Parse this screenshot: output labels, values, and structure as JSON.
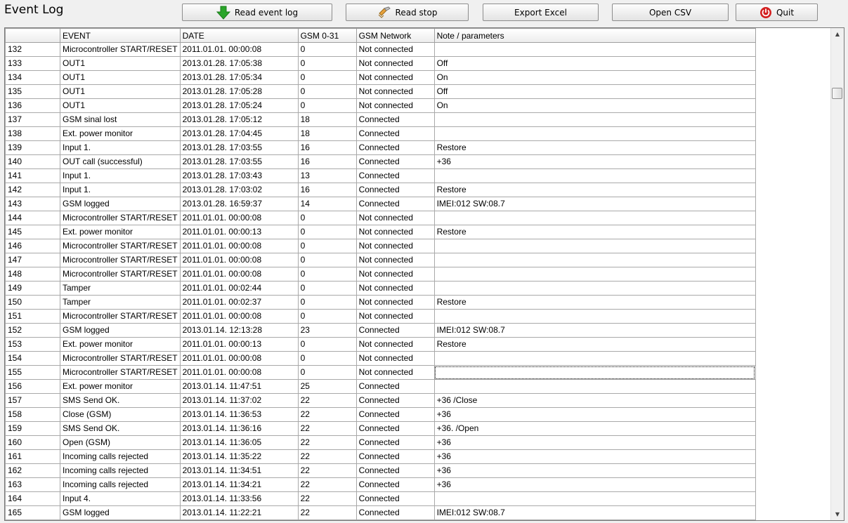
{
  "window": {
    "title": "Event Log"
  },
  "toolbar": {
    "read_label": "Read event log",
    "stop_label": "Read stop",
    "export_label": "Export Excel",
    "open_label": "Open CSV",
    "quit_label": "Quit"
  },
  "icons": {
    "read": "green-down-arrow-icon",
    "stop": "broom-icon",
    "quit": "power-icon"
  },
  "colors": {
    "read_icon": "#2aa52a",
    "quit_icon": "#d32020"
  },
  "columns": [
    "",
    "EVENT",
    "DATE",
    "GSM 0-31",
    "GSM Network",
    "Note / parameters"
  ],
  "rows": [
    {
      "n": "132",
      "event": "Microcontroller START/RESET",
      "date": "2011.01.01.   00:00:08",
      "gsm": "0",
      "net": "Not connected",
      "note": ""
    },
    {
      "n": "133",
      "event": "OUT1",
      "date": "2013.01.28.   17:05:38",
      "gsm": "0",
      "net": "Not connected",
      "note": "Off"
    },
    {
      "n": "134",
      "event": "OUT1",
      "date": "2013.01.28.   17:05:34",
      "gsm": "0",
      "net": "Not connected",
      "note": "On"
    },
    {
      "n": "135",
      "event": "OUT1",
      "date": "2013.01.28.   17:05:28",
      "gsm": "0",
      "net": "Not connected",
      "note": "Off"
    },
    {
      "n": "136",
      "event": "OUT1",
      "date": "2013.01.28.   17:05:24",
      "gsm": "0",
      "net": "Not connected",
      "note": "On"
    },
    {
      "n": "137",
      "event": "GSM sinal lost",
      "date": "2013.01.28.   17:05:12",
      "gsm": "18",
      "net": "Connected",
      "note": ""
    },
    {
      "n": "138",
      "event": "Ext. power monitor",
      "date": "2013.01.28.   17:04:45",
      "gsm": "18",
      "net": "Connected",
      "note": ""
    },
    {
      "n": "139",
      "event": "Input 1.",
      "date": "2013.01.28.   17:03:55",
      "gsm": "16",
      "net": "Connected",
      "note": "Restore"
    },
    {
      "n": "140",
      "event": "OUT call (successful)",
      "date": "2013.01.28.   17:03:55",
      "gsm": "16",
      "net": "Connected",
      "note": "+36"
    },
    {
      "n": "141",
      "event": "Input 1.",
      "date": "2013.01.28.   17:03:43",
      "gsm": "13",
      "net": "Connected",
      "note": ""
    },
    {
      "n": "142",
      "event": "Input 1.",
      "date": "2013.01.28.   17:03:02",
      "gsm": "16",
      "net": "Connected",
      "note": "Restore"
    },
    {
      "n": "143",
      "event": "GSM logged",
      "date": "2013.01.28.   16:59:37",
      "gsm": "14",
      "net": "Connected",
      "note": "IMEI:012                        SW:08.7"
    },
    {
      "n": "144",
      "event": "Microcontroller START/RESET",
      "date": "2011.01.01.   00:00:08",
      "gsm": "0",
      "net": "Not connected",
      "note": ""
    },
    {
      "n": "145",
      "event": "Ext. power monitor",
      "date": "2011.01.01.   00:00:13",
      "gsm": "0",
      "net": "Not connected",
      "note": "Restore"
    },
    {
      "n": "146",
      "event": "Microcontroller START/RESET",
      "date": "2011.01.01.   00:00:08",
      "gsm": "0",
      "net": "Not connected",
      "note": ""
    },
    {
      "n": "147",
      "event": "Microcontroller START/RESET",
      "date": "2011.01.01.   00:00:08",
      "gsm": "0",
      "net": "Not connected",
      "note": ""
    },
    {
      "n": "148",
      "event": "Microcontroller START/RESET",
      "date": "2011.01.01.   00:00:08",
      "gsm": "0",
      "net": "Not connected",
      "note": ""
    },
    {
      "n": "149",
      "event": "Tamper",
      "date": "2011.01.01.   00:02:44",
      "gsm": "0",
      "net": "Not connected",
      "note": ""
    },
    {
      "n": "150",
      "event": "Tamper",
      "date": "2011.01.01.   00:02:37",
      "gsm": "0",
      "net": "Not connected",
      "note": "Restore"
    },
    {
      "n": "151",
      "event": "Microcontroller START/RESET",
      "date": "2011.01.01.   00:00:08",
      "gsm": "0",
      "net": "Not connected",
      "note": ""
    },
    {
      "n": "152",
      "event": "GSM logged",
      "date": "2013.01.14.   12:13:28",
      "gsm": "23",
      "net": "Connected",
      "note": "IMEI:012                        SW:08.7"
    },
    {
      "n": "153",
      "event": "Ext. power monitor",
      "date": "2011.01.01.   00:00:13",
      "gsm": "0",
      "net": "Not connected",
      "note": "Restore"
    },
    {
      "n": "154",
      "event": "Microcontroller START/RESET",
      "date": "2011.01.01.   00:00:08",
      "gsm": "0",
      "net": "Not connected",
      "note": ""
    },
    {
      "n": "155",
      "event": "Microcontroller START/RESET",
      "date": "2011.01.01.   00:00:08",
      "gsm": "0",
      "net": "Not connected",
      "note": ""
    },
    {
      "n": "156",
      "event": "Ext. power monitor",
      "date": "2013.01.14.   11:47:51",
      "gsm": "25",
      "net": "Connected",
      "note": ""
    },
    {
      "n": "157",
      "event": "SMS Send OK.",
      "date": "2013.01.14.   11:37:02",
      "gsm": "22",
      "net": "Connected",
      "note": "+36                   /Close"
    },
    {
      "n": "158",
      "event": "Close (GSM)",
      "date": "2013.01.14.   11:36:53",
      "gsm": "22",
      "net": "Connected",
      "note": "+36"
    },
    {
      "n": "159",
      "event": "SMS Send OK.",
      "date": "2013.01.14.   11:36:16",
      "gsm": "22",
      "net": "Connected",
      "note": "+36.                  /Open"
    },
    {
      "n": "160",
      "event": "Open (GSM)",
      "date": "2013.01.14.   11:36:05",
      "gsm": "22",
      "net": "Connected",
      "note": "+36"
    },
    {
      "n": "161",
      "event": "Incoming calls rejected",
      "date": "2013.01.14.   11:35:22",
      "gsm": "22",
      "net": "Connected",
      "note": "+36"
    },
    {
      "n": "162",
      "event": "Incoming calls rejected",
      "date": "2013.01.14.   11:34:51",
      "gsm": "22",
      "net": "Connected",
      "note": "+36"
    },
    {
      "n": "163",
      "event": "Incoming calls rejected",
      "date": "2013.01.14.   11:34:21",
      "gsm": "22",
      "net": "Connected",
      "note": "+36"
    },
    {
      "n": "164",
      "event": "Input 4.",
      "date": "2013.01.14.   11:33:56",
      "gsm": "22",
      "net": "Connected",
      "note": ""
    },
    {
      "n": "165",
      "event": "GSM logged",
      "date": "2013.01.14.   11:22:21",
      "gsm": "22",
      "net": "Connected",
      "note": "IMEI:012                        SW:08.7"
    }
  ]
}
